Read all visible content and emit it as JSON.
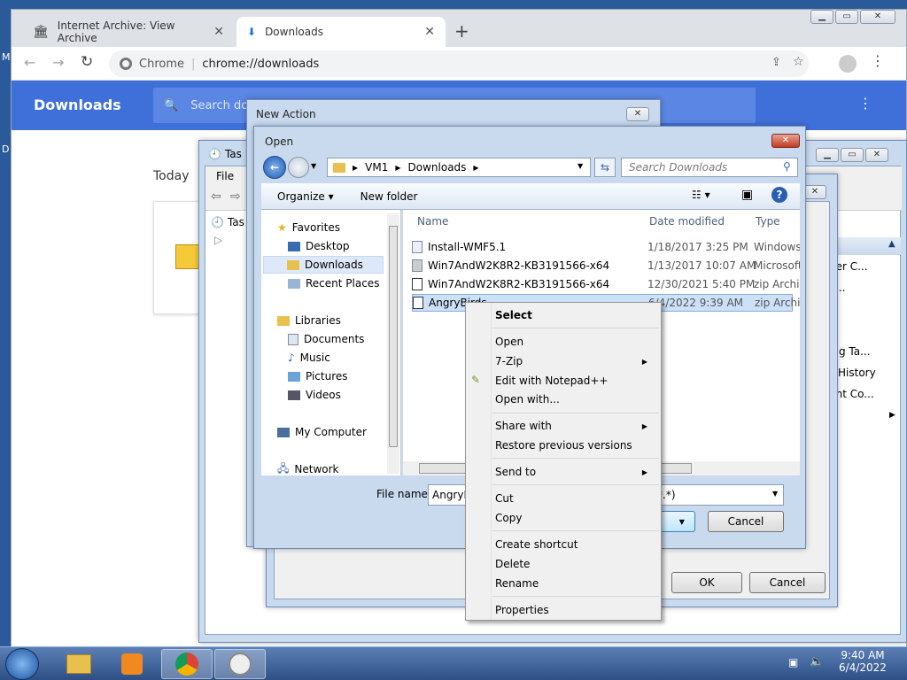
{
  "chrome": {
    "tabs": [
      {
        "label": "Internet Archive: View Archive",
        "close": "✕"
      },
      {
        "label": "Downloads",
        "close": "✕"
      }
    ],
    "new_tab": "+",
    "omnibox_site": "Chrome",
    "omnibox_url": "chrome://downloads",
    "page_title": "Downloads",
    "search_placeholder": "Search dow",
    "date_group": "Today"
  },
  "new_action": {
    "title": "New Action"
  },
  "task_scheduler": {
    "title": "Tas",
    "menu_file": "File",
    "menu_a": "A",
    "tree_item": "Tas",
    "right_items": [
      "l)",
      "her C...",
      "k...",
      "ing Ta...",
      "History",
      "unt Co..."
    ]
  },
  "open_dialog": {
    "title": "Open",
    "address": [
      "VM1",
      "Downloads"
    ],
    "search_placeholder": "Search Downloads",
    "organize": "Organize",
    "new_folder": "New folder",
    "nav": {
      "favorites": "Favorites",
      "desktop": "Desktop",
      "downloads": "Downloads",
      "recent": "Recent Places",
      "libraries": "Libraries",
      "documents": "Documents",
      "music": "Music",
      "pictures": "Pictures",
      "videos": "Videos",
      "computer": "My Computer",
      "network": "Network"
    },
    "columns": {
      "name": "Name",
      "date": "Date modified",
      "type": "Type"
    },
    "files": [
      {
        "name": "Install-WMF5.1",
        "date": "1/18/2017 3:25 PM",
        "type": "Windows"
      },
      {
        "name": "Win7AndW2K8R2-KB3191566-x64",
        "date": "1/13/2017 10:07 AM",
        "type": "Microsoft"
      },
      {
        "name": "Win7AndW2K8R2-KB3191566-x64",
        "date": "12/30/2021 5:40 PM",
        "type": "zip Archiv"
      },
      {
        "name": "AngryBirds",
        "date": "6/4/2022 9:39 AM",
        "type": "zip Archiv"
      }
    ],
    "filename_label": "File name:",
    "filename_value": "AngryB",
    "filter": "*.*)",
    "open_btn": "n",
    "cancel": "Cancel"
  },
  "bg_dialog": {
    "ok": "OK",
    "cancel": "Cancel"
  },
  "context_menu": {
    "select": "Select",
    "open": "Open",
    "zip": "7-Zip",
    "notepad": "Edit with Notepad++",
    "open_with": "Open with...",
    "share": "Share with",
    "restore": "Restore previous versions",
    "send_to": "Send to",
    "cut": "Cut",
    "copy": "Copy",
    "shortcut": "Create shortcut",
    "delete": "Delete",
    "rename": "Rename",
    "properties": "Properties"
  },
  "taskbar": {
    "time": "9:40 AM",
    "date": "6/4/2022"
  },
  "desktop_letters": [
    "M",
    "D"
  ]
}
